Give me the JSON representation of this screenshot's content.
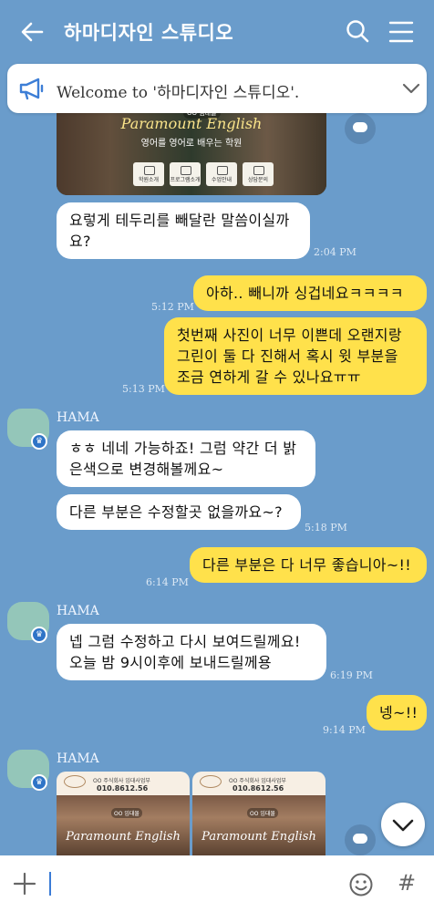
{
  "header": {
    "title": "하마디자인 스튜디오",
    "back_icon": "arrow-left-icon",
    "search_icon": "search-icon",
    "menu_icon": "hamburger-menu-icon"
  },
  "notice": {
    "icon": "megaphone-icon",
    "text": "Welcome to '하마디자인 스튜디오'.",
    "chevron_icon": "chevron-down-icon"
  },
  "messages": {
    "image1": {
      "badge": "OO 임대물",
      "brand": "Paramount English",
      "subtitle": "영어를 영어로 배우는 학원",
      "tiles": [
        "학원소개",
        "프로그램소개",
        "수업안내",
        "상담문의"
      ]
    },
    "m1": {
      "text": "요렇게 테두리를 빼달란 말씀이실까요?",
      "line1": "요렇게 테두리를 빼달란 말씀이실까",
      "line2": "요?",
      "time": "2:04 PM"
    },
    "m2": {
      "text": "아하.. 빼니까 싱겁네요ㅋㅋㅋㅋ",
      "time": "5:12 PM"
    },
    "m3": {
      "line1": "첫번째 사진이 너무 이쁜데 오랜지랑",
      "line2": "그린이 둘 다 진해서 혹시 윗 부분을",
      "line3": "조금 연하게 갈 수 있나요ㅠㅠ",
      "time": "5:13 PM"
    },
    "g2": {
      "sender": "HAMA"
    },
    "m4": {
      "line1": "ㅎㅎ 네네 가능하죠! 그럼 약간 더 밝",
      "line2": "은색으로 변경해볼께요~"
    },
    "m5": {
      "text": "다른 부분은 수정할곳 없을까요~?",
      "time": "5:18 PM"
    },
    "m6": {
      "text": "다른 부분은 다 너무 좋습니아~!!",
      "time": "6:14 PM"
    },
    "g3": {
      "sender": "HAMA"
    },
    "m7": {
      "line1": "넵 그럼 수정하고 다시 보여드릴께요!",
      "line2": "오늘 밤 9시이후에 보내드릴께용",
      "time": "6:19 PM"
    },
    "m8": {
      "text": "넹~!!",
      "time": "9:14 PM"
    },
    "g4": {
      "sender": "HAMA",
      "thumbs": [
        {
          "header_small": "OO 주식회사 임대사업부",
          "header_phone": "010.8612.56",
          "badge": "OO 임대물",
          "brand": "Paramount English"
        },
        {
          "header_small": "OO 주식회사 임대사업부",
          "header_phone": "010.8612.56",
          "badge": "OO 임대물",
          "brand": "Paramount English"
        }
      ]
    }
  },
  "input": {
    "plus_icon": "plus-icon",
    "emoji_icon": "emoji-icon",
    "hash_label": "#"
  },
  "colors": {
    "background": "#6a9ccb",
    "outgoing_bubble": "#ffe14b",
    "incoming_bubble": "#ffffff",
    "avatar": "#94c6b9"
  }
}
